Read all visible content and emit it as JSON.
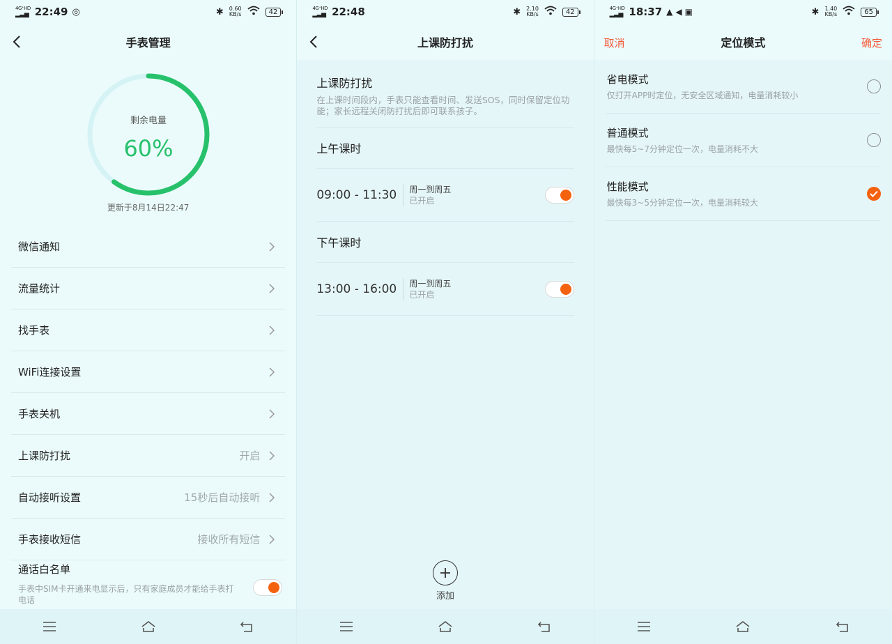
{
  "screens": [
    {
      "status": {
        "network": "4G⁺HD",
        "time": "22:49",
        "speed": "0.60",
        "speed_unit": "KB/s",
        "battery": "42"
      },
      "title": "手表管理",
      "battery_card": {
        "label": "剩余电量",
        "value": "60%",
        "percent": 0.6,
        "updated": "更新于8月14日22:47"
      },
      "menu": [
        {
          "label": "微信通知",
          "value": ""
        },
        {
          "label": "流量统计",
          "value": ""
        },
        {
          "label": "找手表",
          "value": ""
        },
        {
          "label": "WiFi连接设置",
          "value": ""
        },
        {
          "label": "手表关机",
          "value": ""
        },
        {
          "label": "上课防打扰",
          "value": "开启"
        },
        {
          "label": "自动接听设置",
          "value": "15秒后自动接听"
        },
        {
          "label": "手表接收短信",
          "value": "接收所有短信"
        }
      ],
      "whitelist": {
        "label": "通话白名单",
        "desc": "手表中SIM卡开通来电显示后，只有家庭成员才能给手表打电话",
        "enabled": true
      }
    },
    {
      "status": {
        "network": "4G⁺HD",
        "time": "22:48",
        "speed": "2.10",
        "speed_unit": "KB/s",
        "battery": "42"
      },
      "title": "上课防打扰",
      "intro": {
        "title": "上课防打扰",
        "desc": "在上课时间段内，手表只能查看时间、发送SOS，同时保留定位功能；家长远程关闭防打扰后即可联系孩子。"
      },
      "morning": {
        "label": "上午课时",
        "range": "09:00 - 11:30",
        "days": "周一到周五",
        "state": "已开启",
        "enabled": true
      },
      "afternoon": {
        "label": "下午课时",
        "range": "13:00 - 16:00",
        "days": "周一到周五",
        "state": "已开启",
        "enabled": true
      },
      "add_label": "添加"
    },
    {
      "status": {
        "network": "4G⁺HD",
        "time": "18:37",
        "speed": "1.40",
        "speed_unit": "KB/s",
        "battery": "65"
      },
      "title": "定位模式",
      "cancel_label": "取消",
      "confirm_label": "确定",
      "modes": [
        {
          "name": "省电模式",
          "desc": "仅打开APP时定位，无安全区域通知，电量消耗较小",
          "selected": false
        },
        {
          "name": "普通模式",
          "desc": "最快每5~7分钟定位一次，电量消耗不大",
          "selected": false
        },
        {
          "name": "性能模式",
          "desc": "最快每3~5分钟定位一次，电量消耗较大",
          "selected": true
        }
      ]
    }
  ],
  "colors": {
    "accent": "#f5620f",
    "ring": "#27c16b",
    "header_action": "#f45b3b"
  },
  "icons": [
    "back-icon",
    "chevron-right-icon",
    "bluetooth-icon",
    "wifi-icon",
    "menu-icon",
    "home-icon",
    "return-icon",
    "plus-icon",
    "check-icon",
    "bell-icon",
    "mute-icon"
  ]
}
